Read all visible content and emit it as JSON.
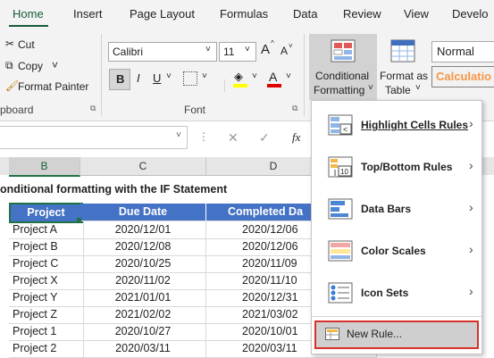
{
  "ribbon_tabs": [
    "Home",
    "Insert",
    "Page Layout",
    "Formulas",
    "Data",
    "Review",
    "View",
    "Develo"
  ],
  "clipboard": {
    "cut": "Cut",
    "copy": "Copy",
    "format_painter": "Format Painter",
    "group_label": "pboard"
  },
  "font": {
    "name": "Calibri",
    "size": "11",
    "group_label": "Font",
    "bold": "B",
    "italic": "I",
    "underline": "U",
    "grow": "A",
    "shrink": "A",
    "font_color": "A"
  },
  "styles": {
    "conditional_formatting_line1": "Conditional",
    "conditional_formatting_line2": "Formatting",
    "format_as_table_line1": "Format as",
    "format_as_table_line2": "Table",
    "normal": "Normal",
    "calculation": "Calculatio"
  },
  "formula_bar": {
    "fx": "fx",
    "cancel": "✕",
    "enter": "✓"
  },
  "columns": [
    "B",
    "C",
    "D"
  ],
  "sheet_title": "onditional formatting with the IF Statement",
  "table": {
    "headers": [
      "Project",
      "Due Date",
      "Completed Da"
    ],
    "rows": [
      [
        "Project A",
        "2020/12/01",
        "2020/12/06"
      ],
      [
        "Project B",
        "2020/12/08",
        "2020/12/06"
      ],
      [
        "Project C",
        "2020/10/25",
        "2020/11/09"
      ],
      [
        "Project X",
        "2020/11/02",
        "2020/11/10"
      ],
      [
        "Project Y",
        "2021/01/01",
        "2020/12/31"
      ],
      [
        "Project Z",
        "2021/02/02",
        "2021/03/02"
      ],
      [
        "Project 1",
        "2020/10/27",
        "2020/10/01"
      ],
      [
        "Project 2",
        "2020/03/11",
        "2020/03/11"
      ]
    ]
  },
  "menu": {
    "items": [
      "Highlight Cells Rules",
      "Top/Bottom Rules",
      "Data Bars",
      "Color Scales",
      "Icon Sets"
    ],
    "new_rule": "New Rule...",
    "highlight_color": "#d9312b"
  },
  "colors": {
    "accent": "#185c37",
    "table_header": "#4472c4",
    "calculation_text": "#f79646"
  }
}
